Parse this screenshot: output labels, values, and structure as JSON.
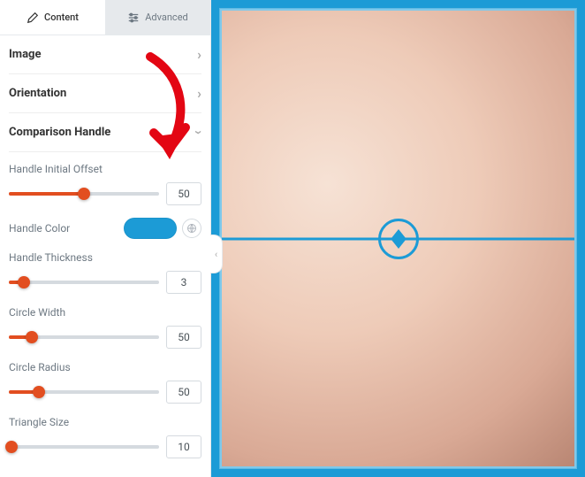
{
  "tabs": {
    "content_label": "Content",
    "advanced_label": "Advanced"
  },
  "sections": {
    "image_title": "Image",
    "orientation_title": "Orientation",
    "comparison_handle_title": "Comparison Handle"
  },
  "controls": {
    "handle_initial_offset": {
      "label": "Handle Initial Offset",
      "value": "50",
      "pct": 50
    },
    "handle_color": {
      "label": "Handle Color",
      "value_hex": "#1c9bd6"
    },
    "handle_thickness": {
      "label": "Handle Thickness",
      "value": "3",
      "pct": 10
    },
    "circle_width": {
      "label": "Circle Width",
      "value": "50",
      "pct": 15
    },
    "circle_radius": {
      "label": "Circle Radius",
      "value": "50",
      "pct": 20
    },
    "triangle_size": {
      "label": "Triangle Size",
      "value": "10",
      "pct": 2
    }
  },
  "preview": {
    "accent_hex": "#1c9bd6",
    "handle_offset_pct": 50
  },
  "annotation": {
    "arrow_color": "#e30613"
  }
}
